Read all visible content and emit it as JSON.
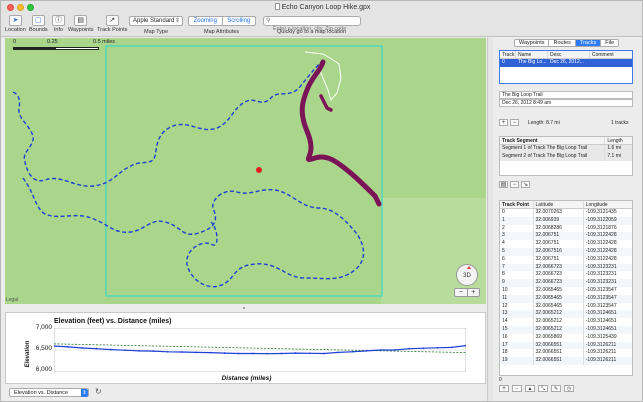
{
  "window": {
    "title": "Echo Canyon Loop Hike.gpx"
  },
  "toolbar": {
    "location": "Location",
    "bounds": "Bounds",
    "info": "Info",
    "waypoints": "Waypoints",
    "track_points": "Track Points",
    "map_type_value": "Apple Standard",
    "map_type_label": "Map Type",
    "zooming": "Zooming",
    "scrolling": "Scrolling",
    "map_attributes_label": "Map Attributes",
    "search_placeholder": "Enter a location, city, Zip code",
    "search_label": "Quickly go to a map location"
  },
  "map": {
    "scale_0": "0",
    "scale_mid": "0.25",
    "scale_end": "0.5 miles",
    "legal": "Legal",
    "compass": "3D",
    "zoom_out": "−",
    "zoom_in": "+"
  },
  "chart_data": {
    "type": "line",
    "title": "Elevation (feet) vs. Distance (miles)",
    "xlabel": "Distance (miles)",
    "ylabel": "Elevation",
    "ylim": [
      6000,
      7000
    ],
    "yticks": [
      "7,000",
      "6,500",
      "6,000"
    ],
    "grid": true,
    "series": [
      {
        "x": [
          0,
          0.3,
          0.6,
          0.9,
          1.2,
          1.5,
          1.8,
          2.1,
          2.4,
          2.7,
          3.0,
          3.3,
          3.6,
          3.9,
          4.2,
          4.5,
          4.8,
          5.1,
          5.4,
          5.7,
          6.0,
          6.3,
          6.6,
          6.9,
          7.2,
          7.5,
          7.8,
          8.1,
          8.4,
          8.7
        ],
        "y": [
          6590,
          6570,
          6545,
          6530,
          6510,
          6495,
          6480,
          6475,
          6460,
          6455,
          6445,
          6440,
          6430,
          6420,
          6420,
          6415,
          6420,
          6430,
          6425,
          6420,
          6445,
          6460,
          6480,
          6500,
          6500,
          6530,
          6540,
          6550,
          6560,
          6600
        ]
      }
    ],
    "trend": {
      "y_start": 6640,
      "y_end": 6440
    }
  },
  "bottom": {
    "plot_select": "Elevation vs. Distance",
    "refresh": "↻"
  },
  "panel": {
    "tabs": [
      "Waypoints",
      "Routes",
      "Tracks",
      "File"
    ],
    "active_tab": "Tracks",
    "tracks_table": {
      "headers": [
        "Track",
        "Name",
        "Desc",
        "Comment"
      ],
      "rows": [
        [
          "0",
          "The Big Lo...",
          "Dec 26, 2012...",
          ""
        ]
      ]
    },
    "track_name": "The Big Loop Trail",
    "track_date": "Dec 26, 2012  8:49 am",
    "length_text": "Length: 8.7 mi",
    "track_count": "1 tracks",
    "segments_table": {
      "headers": [
        "Track Segment",
        "Length"
      ],
      "rows": [
        [
          "Segment 1 of Track The Big Loop Trail",
          "1.6 mi"
        ],
        [
          "Segment 2 of Track The Big Loop Trail",
          "7.1 mi"
        ]
      ]
    },
    "points_table": {
      "headers": [
        "Track Point",
        "Latitude",
        "Longitude"
      ],
      "rows": [
        [
          "0",
          "32.0070263",
          "-109.3121435"
        ],
        [
          "1",
          "32.006939",
          "-109.3122059"
        ],
        [
          "2",
          "32.0068286",
          "-109.3121876"
        ],
        [
          "3",
          "32.006751",
          "-109.3122428"
        ],
        [
          "4",
          "32.006751",
          "-109.3122428"
        ],
        [
          "5",
          "32.0067516",
          "-109.3122428"
        ],
        [
          "6",
          "32.006751",
          "-109.3122428"
        ],
        [
          "7",
          "32.0066723",
          "-109.3123231"
        ],
        [
          "8",
          "32.0066723",
          "-109.3123231"
        ],
        [
          "9",
          "32.0066723",
          "-109.3123231"
        ],
        [
          "10",
          "32.0065465",
          "-109.3123547"
        ],
        [
          "11",
          "32.0065465",
          "-109.3123547"
        ],
        [
          "12",
          "32.0065465",
          "-109.3123547"
        ],
        [
          "13",
          "32.0065212",
          "-109.3124651"
        ],
        [
          "14",
          "32.0065212",
          "-109.3124651"
        ],
        [
          "15",
          "32.0065212",
          "-109.3124651"
        ],
        [
          "16",
          "32.0065869",
          "-109.3125439"
        ],
        [
          "17",
          "32.0066551",
          "-109.3126211"
        ],
        [
          "18",
          "32.0066551",
          "-109.3126211"
        ],
        [
          "19",
          "32.0066551",
          "-109.3126211"
        ]
      ]
    },
    "points_footer": "0"
  },
  "colors": {
    "map_bg": "#a9d68a",
    "route": "#1d3fd6",
    "track": "#7b1457",
    "accent": "#2f7cf6",
    "bounds": "#3cd6c8"
  }
}
